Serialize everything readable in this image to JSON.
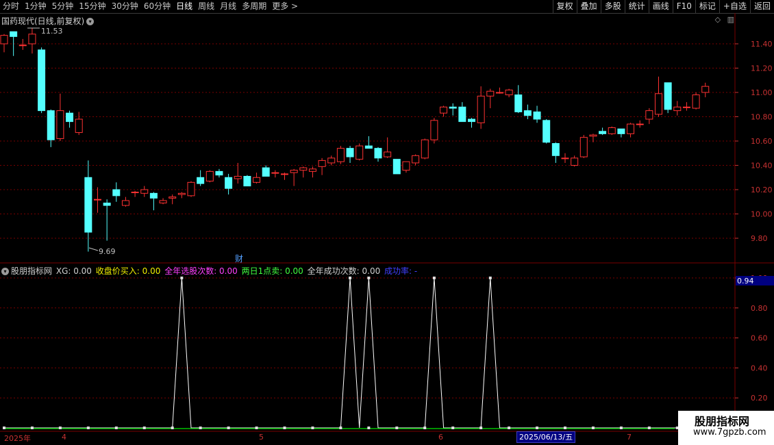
{
  "toolbar": {
    "tabs": [
      "分时",
      "1分钟",
      "5分钟",
      "15分钟",
      "30分钟",
      "60分钟",
      "日线",
      "周线",
      "月线",
      "多周期",
      "更多 >"
    ],
    "active_tab": 6,
    "right_buttons": [
      "复权",
      "叠加",
      "多股",
      "统计",
      "画线",
      "F10",
      "标记",
      "+自选",
      "返回"
    ]
  },
  "main_chart": {
    "title": "国药现代(日线,前复权)",
    "high_label": "11.53",
    "low_label": "9.69",
    "event_marker": "财",
    "y_ticks": [
      "11.40",
      "11.20",
      "11.00",
      "10.80",
      "10.60",
      "10.40",
      "10.20",
      "10.00",
      "9.80"
    ]
  },
  "indicator": {
    "name": "股朋指标网",
    "items": [
      {
        "label": "XG: 0.00",
        "color": "#d0d0d0"
      },
      {
        "label": "收盘价买入: 0.00",
        "color": "#f0f000"
      },
      {
        "label": "全年选股次数: 0.00",
        "color": "#ff40ff"
      },
      {
        "label": "两日1点卖: 0.00",
        "color": "#40ff40"
      },
      {
        "label": "全年成功次数: 0.00",
        "color": "#d0d0d0"
      },
      {
        "label": "成功率: -",
        "color": "#4040ff"
      }
    ],
    "y_ticks": [
      "1.00",
      "0.80",
      "0.60",
      "0.40",
      "0.20"
    ],
    "current_value": "0.94"
  },
  "x_axis": {
    "labels": [
      "2025年",
      "4",
      "5",
      "6",
      "7"
    ],
    "cursor_date": "2025/06/13/五"
  },
  "colors": {
    "up": "#ff3232",
    "down": "#54ffff",
    "grid": "#7a0000",
    "line": "#ffffff",
    "base": "#00c000"
  },
  "chart_data": {
    "type": "candlestick",
    "price_ylim": [
      9.69,
      11.53
    ],
    "candles": [
      {
        "o": 11.4,
        "h": 11.48,
        "l": 11.33,
        "c": 11.47
      },
      {
        "o": 11.5,
        "h": 11.5,
        "l": 11.3,
        "c": 11.46
      },
      {
        "o": 11.39,
        "h": 11.44,
        "l": 11.35,
        "c": 11.39
      },
      {
        "o": 11.4,
        "h": 11.53,
        "l": 11.32,
        "c": 11.48
      },
      {
        "o": 11.35,
        "h": 11.37,
        "l": 10.83,
        "c": 10.85
      },
      {
        "o": 10.85,
        "h": 10.86,
        "l": 10.55,
        "c": 10.61
      },
      {
        "o": 10.62,
        "h": 10.99,
        "l": 10.6,
        "c": 10.85
      },
      {
        "o": 10.83,
        "h": 10.85,
        "l": 10.71,
        "c": 10.76
      },
      {
        "o": 10.67,
        "h": 10.84,
        "l": 10.65,
        "c": 10.78
      },
      {
        "o": 10.3,
        "h": 10.44,
        "l": 9.69,
        "c": 9.85
      },
      {
        "o": 10.12,
        "h": 10.22,
        "l": 10.01,
        "c": 10.12
      },
      {
        "o": 10.09,
        "h": 10.12,
        "l": 9.78,
        "c": 10.07
      },
      {
        "o": 10.2,
        "h": 10.26,
        "l": 10.1,
        "c": 10.15
      },
      {
        "o": 10.07,
        "h": 10.14,
        "l": 10.06,
        "c": 10.11
      },
      {
        "o": 10.18,
        "h": 10.19,
        "l": 10.14,
        "c": 10.18
      },
      {
        "o": 10.17,
        "h": 10.23,
        "l": 10.14,
        "c": 10.2
      },
      {
        "o": 10.17,
        "h": 10.18,
        "l": 10.03,
        "c": 10.13
      },
      {
        "o": 10.09,
        "h": 10.13,
        "l": 10.08,
        "c": 10.11
      },
      {
        "o": 10.13,
        "h": 10.16,
        "l": 10.08,
        "c": 10.14
      },
      {
        "o": 10.16,
        "h": 10.18,
        "l": 10.13,
        "c": 10.17
      },
      {
        "o": 10.15,
        "h": 10.27,
        "l": 10.14,
        "c": 10.26
      },
      {
        "o": 10.3,
        "h": 10.36,
        "l": 10.23,
        "c": 10.25
      },
      {
        "o": 10.27,
        "h": 10.36,
        "l": 10.26,
        "c": 10.35
      },
      {
        "o": 10.35,
        "h": 10.37,
        "l": 10.3,
        "c": 10.32
      },
      {
        "o": 10.3,
        "h": 10.33,
        "l": 10.16,
        "c": 10.21
      },
      {
        "o": 10.29,
        "h": 10.42,
        "l": 10.25,
        "c": 10.31
      },
      {
        "o": 10.31,
        "h": 10.32,
        "l": 10.24,
        "c": 10.23
      },
      {
        "o": 10.26,
        "h": 10.34,
        "l": 10.25,
        "c": 10.3
      },
      {
        "o": 10.38,
        "h": 10.4,
        "l": 10.31,
        "c": 10.31
      },
      {
        "o": 10.34,
        "h": 10.36,
        "l": 10.3,
        "c": 10.34
      },
      {
        "o": 10.33,
        "h": 10.34,
        "l": 10.28,
        "c": 10.33
      },
      {
        "o": 10.34,
        "h": 10.37,
        "l": 10.23,
        "c": 10.36
      },
      {
        "o": 10.36,
        "h": 10.39,
        "l": 10.3,
        "c": 10.38
      },
      {
        "o": 10.35,
        "h": 10.39,
        "l": 10.3,
        "c": 10.37
      },
      {
        "o": 10.39,
        "h": 10.46,
        "l": 10.32,
        "c": 10.44
      },
      {
        "o": 10.42,
        "h": 10.48,
        "l": 10.4,
        "c": 10.46
      },
      {
        "o": 10.43,
        "h": 10.56,
        "l": 10.41,
        "c": 10.54
      },
      {
        "o": 10.54,
        "h": 10.56,
        "l": 10.42,
        "c": 10.47
      },
      {
        "o": 10.45,
        "h": 10.58,
        "l": 10.44,
        "c": 10.56
      },
      {
        "o": 10.56,
        "h": 10.64,
        "l": 10.54,
        "c": 10.54
      },
      {
        "o": 10.54,
        "h": 10.55,
        "l": 10.43,
        "c": 10.46
      },
      {
        "o": 10.47,
        "h": 10.63,
        "l": 10.46,
        "c": 10.51
      },
      {
        "o": 10.45,
        "h": 10.45,
        "l": 10.33,
        "c": 10.33
      },
      {
        "o": 10.36,
        "h": 10.43,
        "l": 10.34,
        "c": 10.43
      },
      {
        "o": 10.42,
        "h": 10.49,
        "l": 10.4,
        "c": 10.48
      },
      {
        "o": 10.46,
        "h": 10.62,
        "l": 10.45,
        "c": 10.61
      },
      {
        "o": 10.61,
        "h": 10.79,
        "l": 10.58,
        "c": 10.77
      },
      {
        "o": 10.83,
        "h": 10.89,
        "l": 10.8,
        "c": 10.88
      },
      {
        "o": 10.88,
        "h": 10.91,
        "l": 10.81,
        "c": 10.87
      },
      {
        "o": 10.88,
        "h": 10.92,
        "l": 10.76,
        "c": 10.76
      },
      {
        "o": 10.78,
        "h": 10.79,
        "l": 10.71,
        "c": 10.76
      },
      {
        "o": 10.75,
        "h": 11.05,
        "l": 10.7,
        "c": 10.97
      },
      {
        "o": 10.97,
        "h": 11.03,
        "l": 10.87,
        "c": 11.01
      },
      {
        "o": 11.0,
        "h": 11.04,
        "l": 10.99,
        "c": 11.0
      },
      {
        "o": 10.98,
        "h": 11.03,
        "l": 10.96,
        "c": 11.02
      },
      {
        "o": 10.98,
        "h": 11.06,
        "l": 10.83,
        "c": 10.84
      },
      {
        "o": 10.85,
        "h": 10.9,
        "l": 10.78,
        "c": 10.81
      },
      {
        "o": 10.84,
        "h": 10.89,
        "l": 10.75,
        "c": 10.78
      },
      {
        "o": 10.77,
        "h": 10.78,
        "l": 10.58,
        "c": 10.59
      },
      {
        "o": 10.58,
        "h": 10.59,
        "l": 10.42,
        "c": 10.48
      },
      {
        "o": 10.46,
        "h": 10.5,
        "l": 10.42,
        "c": 10.46
      },
      {
        "o": 10.4,
        "h": 10.48,
        "l": 10.39,
        "c": 10.46
      },
      {
        "o": 10.47,
        "h": 10.65,
        "l": 10.46,
        "c": 10.63
      },
      {
        "o": 10.64,
        "h": 10.66,
        "l": 10.59,
        "c": 10.65
      },
      {
        "o": 10.68,
        "h": 10.71,
        "l": 10.65,
        "c": 10.66
      },
      {
        "o": 10.66,
        "h": 10.72,
        "l": 10.65,
        "c": 10.71
      },
      {
        "o": 10.7,
        "h": 10.7,
        "l": 10.63,
        "c": 10.66
      },
      {
        "o": 10.66,
        "h": 10.75,
        "l": 10.63,
        "c": 10.74
      },
      {
        "o": 10.74,
        "h": 10.77,
        "l": 10.71,
        "c": 10.74
      },
      {
        "o": 10.78,
        "h": 10.87,
        "l": 10.74,
        "c": 10.85
      },
      {
        "o": 10.82,
        "h": 11.13,
        "l": 10.8,
        "c": 10.99
      },
      {
        "o": 11.08,
        "h": 11.08,
        "l": 10.83,
        "c": 10.86
      },
      {
        "o": 10.85,
        "h": 10.93,
        "l": 10.81,
        "c": 10.88
      },
      {
        "o": 10.88,
        "h": 10.92,
        "l": 10.85,
        "c": 10.88
      },
      {
        "o": 10.87,
        "h": 11.0,
        "l": 10.86,
        "c": 10.98
      },
      {
        "o": 11.0,
        "h": 11.08,
        "l": 10.96,
        "c": 11.05
      }
    ],
    "indicator_series": {
      "name": "成功率",
      "values": [
        0,
        0,
        0,
        0,
        0,
        0,
        0,
        0,
        0,
        0,
        0,
        0,
        0,
        0,
        0,
        0,
        0,
        0,
        0,
        1,
        0,
        0,
        0,
        0,
        0,
        0,
        0,
        0,
        0,
        0,
        0,
        0,
        0,
        0,
        0,
        0,
        0,
        1,
        0,
        1,
        0,
        0,
        0,
        0,
        0,
        0,
        1,
        0,
        0,
        0,
        0,
        0,
        1,
        0,
        0,
        0,
        0,
        0,
        0,
        0,
        0,
        0,
        0,
        0,
        0,
        0,
        0,
        0,
        0,
        0,
        0,
        0,
        0,
        0,
        0,
        0
      ],
      "ylim": [
        0,
        1.0
      ]
    }
  }
}
